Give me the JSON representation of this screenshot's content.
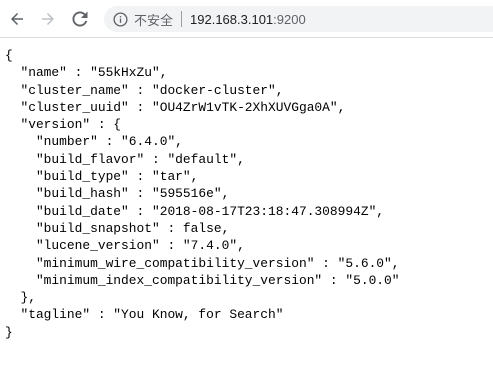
{
  "browser": {
    "security_label": "不安全",
    "url_host": "192.168.3.101",
    "url_port": ":9200",
    "icons": [
      "back-arrow-icon",
      "forward-arrow-icon",
      "reload-icon",
      "info-icon"
    ]
  },
  "json_lines": [
    "{",
    "  \"name\" : \"55kHxZu\",",
    "  \"cluster_name\" : \"docker-cluster\",",
    "  \"cluster_uuid\" : \"OU4ZrW1vTK-2XhXUVGga0A\",",
    "  \"version\" : {",
    "    \"number\" : \"6.4.0\",",
    "    \"build_flavor\" : \"default\",",
    "    \"build_type\" : \"tar\",",
    "    \"build_hash\" : \"595516e\",",
    "    \"build_date\" : \"2018-08-17T23:18:47.308994Z\",",
    "    \"build_snapshot\" : false,",
    "    \"lucene_version\" : \"7.4.0\",",
    "    \"minimum_wire_compatibility_version\" : \"5.6.0\",",
    "    \"minimum_index_compatibility_version\" : \"5.0.0\"",
    "  },",
    "  \"tagline\" : \"You Know, for Search\"",
    "}"
  ]
}
